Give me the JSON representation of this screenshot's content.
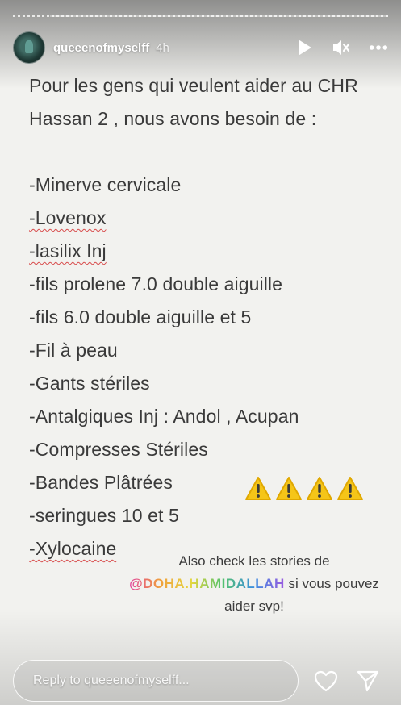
{
  "header": {
    "username": "queeenofmyselff",
    "time": "4h"
  },
  "story": {
    "intro": "Pour les gens qui veulent aider au CHR Hassan 2 , nous avons besoin de :",
    "items": [
      "-Minerve cervicale",
      "-Lovenox",
      "-lasilix Inj",
      "-fils prolene 7.0 double aiguille",
      "-fils 6.0 double aiguille et 5",
      "-Fil à peau",
      "-Gants stériles",
      "-Antalgiques Inj : Andol , Acupan",
      "-Compresses Stériles",
      "-Bandes Plâtrées",
      "-seringues 10 et 5",
      "-Xylocaine"
    ],
    "warning_count": 4,
    "sticker": {
      "line1": "Also check les stories de",
      "mention": "@DOHA.HAMIDALLAH",
      "line2_rest": " si vous pouvez",
      "line3": "aider svp!"
    }
  },
  "footer": {
    "reply_placeholder": "Reply to queeenofmyselff..."
  },
  "icons": {
    "play": "play-icon",
    "mute": "speaker-muted-icon",
    "more": "more-options-icon",
    "like": "heart-icon",
    "share": "send-icon",
    "warning": "warning-icon"
  },
  "colors": {
    "background": "#f2f2ef",
    "text": "#3a3a3a",
    "warning_yellow": "#f5c518"
  }
}
